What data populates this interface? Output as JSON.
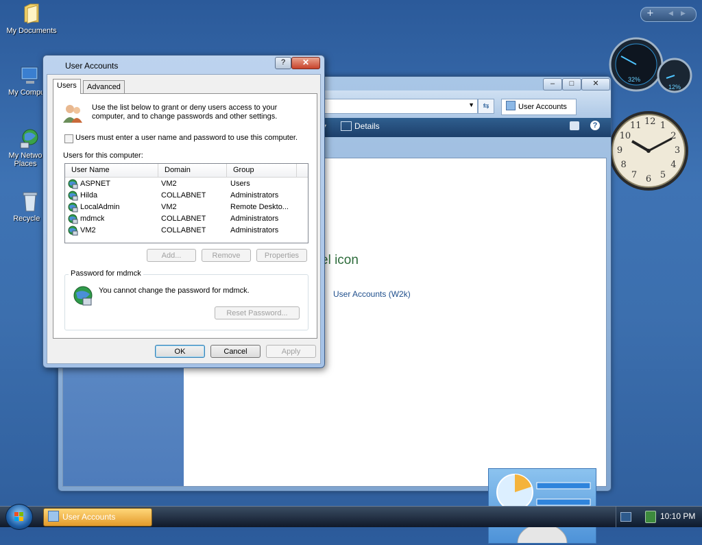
{
  "desktop": {
    "icons": [
      {
        "label": "My Documents",
        "icon": "folder-icon"
      },
      {
        "label": "My Compu",
        "icon": "computer-icon"
      },
      {
        "label_line1": "My Netwo",
        "label_line2": "Places",
        "icon": "network-icon"
      },
      {
        "label": "Recycle B",
        "icon": "recycle-bin-icon"
      }
    ]
  },
  "gadgets": {
    "meter1": "32%",
    "meter2": "12%",
    "clock_numbers": [
      "12",
      "1",
      "2",
      "3",
      "4",
      "5",
      "6",
      "7",
      "8",
      "9",
      "10",
      "11"
    ]
  },
  "explorer": {
    "address_text": "User Accounts",
    "toolbar_details": "Details",
    "heading_fragment": "el icon",
    "link_label": "User Accounts (W2k)"
  },
  "dialog": {
    "title": "User Accounts",
    "help_glyph": "?",
    "close_glyph": "✕",
    "tabs": [
      "Users",
      "Advanced"
    ],
    "intro_text": "Use the list below to grant or deny users access to your computer, and to change passwords and other settings.",
    "must_login_label": "Users must enter a user name and password to use this computer.",
    "must_login_checked": false,
    "users_label": "Users for this computer:",
    "columns": [
      "User Name",
      "Domain",
      "Group"
    ],
    "users": [
      {
        "name": "ASPNET",
        "domain": "VM2",
        "group": "Users"
      },
      {
        "name": "Hilda",
        "domain": "COLLABNET",
        "group": "Administrators"
      },
      {
        "name": "LocalAdmin",
        "domain": "VM2",
        "group": "Remote Deskto..."
      },
      {
        "name": "mdmck",
        "domain": "COLLABNET",
        "group": "Administrators"
      },
      {
        "name": "VM2",
        "domain": "COLLABNET",
        "group": "Administrators"
      }
    ],
    "buttons": {
      "add": "Add...",
      "remove": "Remove",
      "properties": "Properties"
    },
    "password_group_label": "Password for mdmck",
    "password_text": "You cannot change the password for mdmck.",
    "reset_password": "Reset Password...",
    "ok": "OK",
    "cancel": "Cancel",
    "apply": "Apply"
  },
  "taskbar": {
    "task_label": "User Accounts",
    "time": "10:10 PM"
  },
  "colors": {
    "desktop": "#3e73b4",
    "task_active": "#f0b24a",
    "close_button": "#c8432b"
  }
}
